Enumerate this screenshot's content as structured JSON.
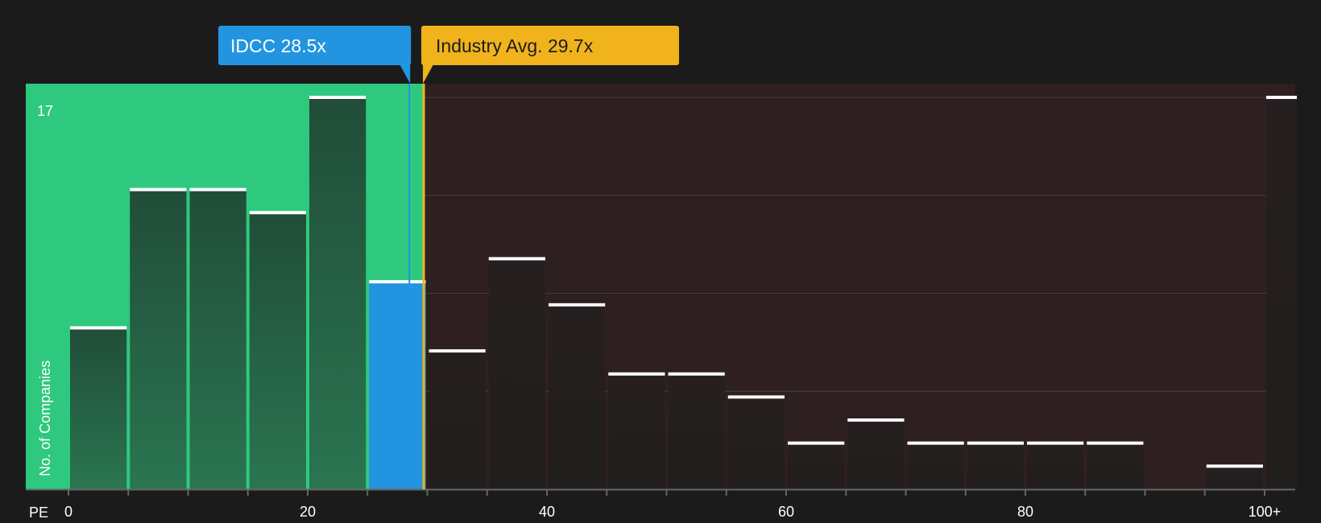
{
  "chart_data": {
    "type": "bar",
    "title": "",
    "xlabel": "PE",
    "ylabel": "No. of Companies",
    "y_top_label": "17",
    "xlim": [
      0,
      100
    ],
    "ylim": [
      0,
      17
    ],
    "bin_width": 5,
    "x_ticks": [
      {
        "value": 0,
        "label": "0"
      },
      {
        "value": 20,
        "label": "20"
      },
      {
        "value": 40,
        "label": "40"
      },
      {
        "value": 60,
        "label": "60"
      },
      {
        "value": 80,
        "label": "80"
      },
      {
        "value": 100,
        "label": "100+"
      }
    ],
    "bins": [
      {
        "x": 0,
        "value": 7
      },
      {
        "x": 5,
        "value": 13
      },
      {
        "x": 10,
        "value": 13
      },
      {
        "x": 15,
        "value": 12
      },
      {
        "x": 20,
        "value": 17
      },
      {
        "x": 25,
        "value": 9,
        "highlight": true
      },
      {
        "x": 30,
        "value": 6
      },
      {
        "x": 35,
        "value": 10
      },
      {
        "x": 40,
        "value": 8
      },
      {
        "x": 45,
        "value": 5
      },
      {
        "x": 50,
        "value": 5
      },
      {
        "x": 55,
        "value": 4
      },
      {
        "x": 60,
        "value": 2
      },
      {
        "x": 65,
        "value": 3
      },
      {
        "x": 70,
        "value": 2
      },
      {
        "x": 75,
        "value": 2
      },
      {
        "x": 80,
        "value": 2
      },
      {
        "x": 85,
        "value": 2
      },
      {
        "x": 90,
        "value": 0
      },
      {
        "x": 95,
        "value": 1
      },
      {
        "x": 100,
        "value": 17
      }
    ],
    "company": {
      "label": "IDCC 28.5x",
      "value": 28.5,
      "color": "#2394e0"
    },
    "industry": {
      "label": "Industry Avg. 29.7x",
      "value": 29.7,
      "color": "#f0b31c"
    },
    "colors": {
      "background": "#1b1b1b",
      "undervalued_zone": "#2ec97e",
      "overvalued_zone": "#2e1f20",
      "bar_green": "#235e41",
      "bar_dark": "#241f1f",
      "highlight_bar": "#2394e0",
      "cap": "#ffffff"
    }
  }
}
